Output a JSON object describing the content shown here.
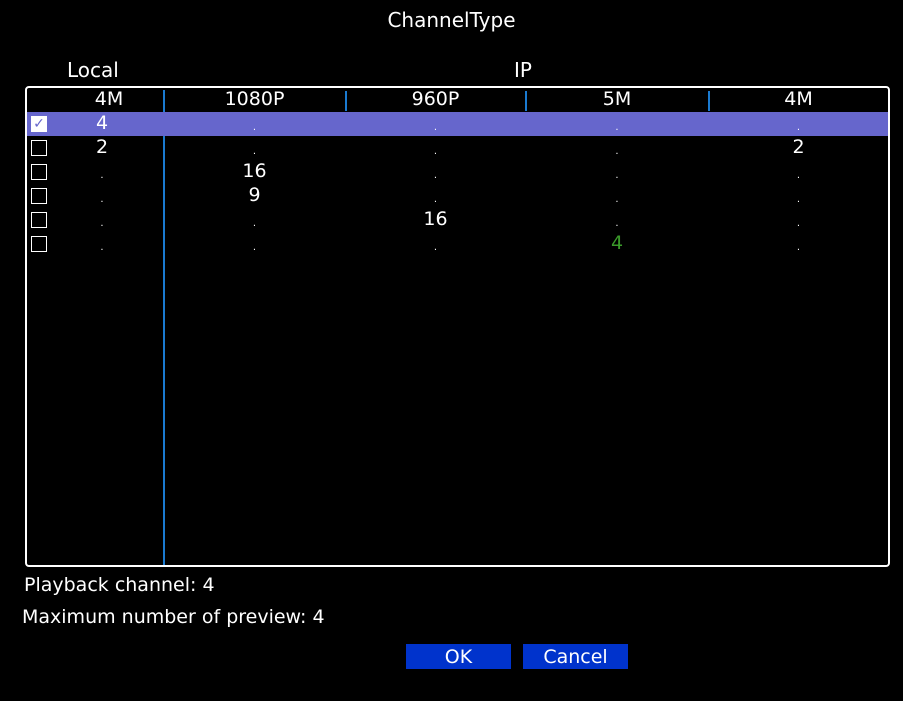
{
  "title": "ChannelType",
  "groups": {
    "local": "Local",
    "ip": "IP"
  },
  "columns": [
    "4M",
    "1080P",
    "960P",
    "5M",
    "4M"
  ],
  "rows": [
    {
      "checked": true,
      "selected": true,
      "values": [
        "4",
        ".",
        ".",
        ".",
        "."
      ]
    },
    {
      "checked": false,
      "selected": false,
      "values": [
        "2",
        ".",
        ".",
        ".",
        "2"
      ]
    },
    {
      "checked": false,
      "selected": false,
      "values": [
        ".",
        "16",
        ".",
        ".",
        "."
      ]
    },
    {
      "checked": false,
      "selected": false,
      "values": [
        ".",
        "9",
        ".",
        ".",
        "."
      ]
    },
    {
      "checked": false,
      "selected": false,
      "values": [
        ".",
        ".",
        "16",
        ".",
        "."
      ]
    },
    {
      "checked": false,
      "selected": false,
      "values": [
        ".",
        ".",
        ".",
        "4",
        "."
      ],
      "highlight_col": 3
    }
  ],
  "playback": "Playback channel: 4",
  "max_preview": "Maximum number of preview: 4",
  "buttons": {
    "ok": "OK",
    "cancel": "Cancel"
  },
  "colors": {
    "selected_row": "#6666cc",
    "highlight_text": "#3a9a2a",
    "button": "#0033cc",
    "separator": "#1a7ad0"
  }
}
